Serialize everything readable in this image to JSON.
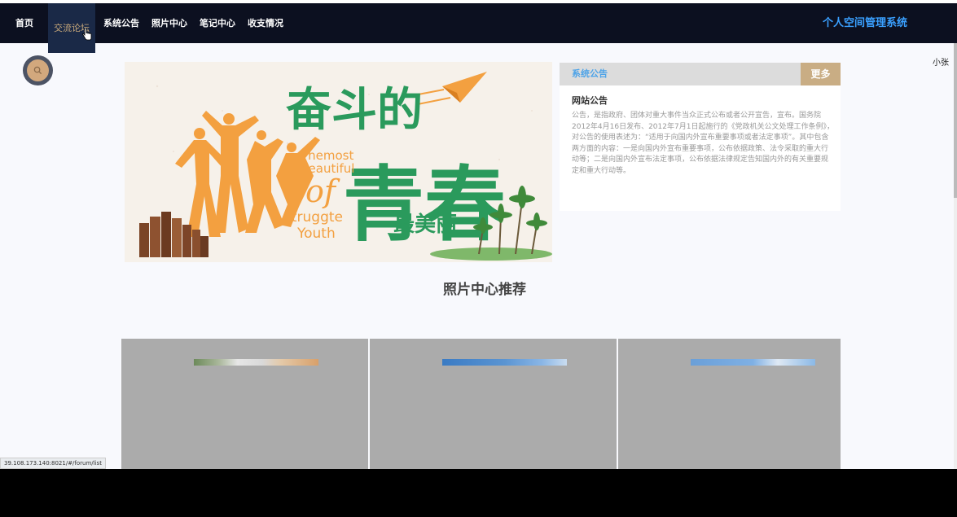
{
  "nav": {
    "items": [
      "首页",
      "交流论坛",
      "系统公告",
      "照片中心",
      "笔记中心",
      "收支情况"
    ],
    "active_index": 1,
    "brand": "个人空间管理系统"
  },
  "user": {
    "name": "小张"
  },
  "banner": {
    "headline_top": "奋斗的",
    "headline_big": "青春",
    "headline_bottom": "最美丽",
    "english_line1": "Themost",
    "english_line2": "beautiful",
    "english_of": "of",
    "english_line3": "struggte",
    "english_line4": "Youth"
  },
  "notice": {
    "header": "系统公告",
    "more": "更多",
    "item_title": "网站公告",
    "item_body": "公告，是指政府、团体对重大事件当众正式公布或者公开宣告，宣布。国务院2012年4月16日发布、2012年7月1日起施行的《党政机关公文处理工作条例》，对公告的使用表述为：“适用于向国内外宣布重要事项或者法定事项”。其中包含两方面的内容：一是向国内外宣布重要事项，公布依据政策、法令采取的重大行动等；二是向国内外宣布法定事项，公布依据法律规定告知国内外的有关重要规定和重大行动等。"
  },
  "photo_section": {
    "title": "照片中心推荐"
  },
  "status": {
    "url": "39.108.173.140:8021/#/forum/list"
  },
  "colors": {
    "nav_bg": "#0c1020",
    "nav_active_bg": "#1a2947",
    "nav_active_text": "#c9a97b",
    "brand": "#3aa0ff",
    "accent_gold": "#c9ad84",
    "notice_title": "#4da3e8",
    "page_bg": "#f8f9fd",
    "banner_green": "#2a9a5c",
    "banner_orange": "#f3a040"
  },
  "icons": {
    "search": "search-icon",
    "cursor": "hand-pointer-icon"
  }
}
